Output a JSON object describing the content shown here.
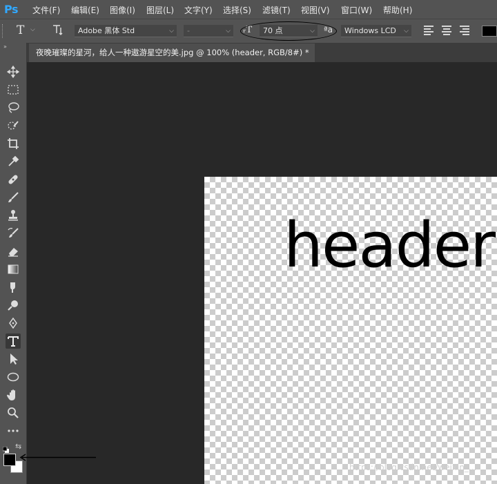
{
  "app": {
    "logo": "Ps"
  },
  "menu": [
    "文件(F)",
    "编辑(E)",
    "图像(I)",
    "图层(L)",
    "文字(Y)",
    "选择(S)",
    "滤镜(T)",
    "视图(V)",
    "窗口(W)",
    "帮助(H)"
  ],
  "options": {
    "font_family": "Adobe 黑体 Std",
    "font_style": "-",
    "font_size": "70 点",
    "anti_alias": "Windows LCD",
    "antialias_glyph": "ªa"
  },
  "document": {
    "tab_title": "夜晚璀璨的星河，给人一种遨游星空的美.jpg @ 100% (header, RGB/8#) *",
    "canvas_text": "header"
  },
  "watermark": "https://blog.csdn.net/weixin_...",
  "colors": {
    "foreground": "#000000",
    "background": "#ffffff",
    "logo": "#31a8ff"
  },
  "tools": [
    "move-icon",
    "marquee-icon",
    "lasso-icon",
    "quick-select-icon",
    "crop-icon",
    "eyedropper-icon",
    "healing-icon",
    "brush-icon",
    "stamp-icon",
    "history-brush-icon",
    "eraser-icon",
    "gradient-icon",
    "smudge-icon",
    "dodge-icon",
    "pen-icon",
    "type-icon",
    "path-select-icon",
    "ellipse-icon",
    "hand-icon",
    "zoom-icon",
    "more-icon"
  ]
}
